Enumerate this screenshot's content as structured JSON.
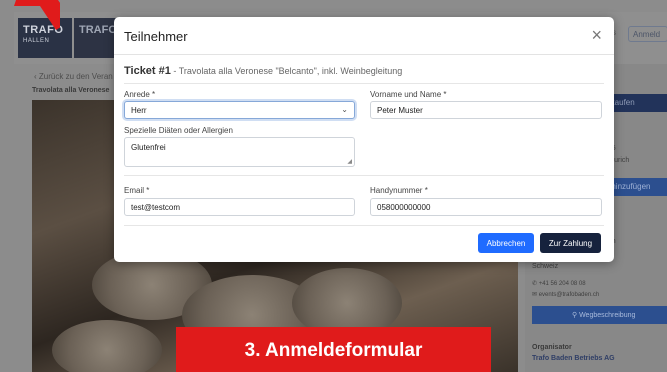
{
  "background": {
    "logo_primary": "TRAFO",
    "logo_primary_sub": "HALLEN",
    "logo_secondary": "TRAFO",
    "header_link": "s",
    "header_button": "Anmeld",
    "back_link": "Zurück zu den Veran",
    "event_title": "Travolata alla Veronese",
    "buy_button": "h kaufen",
    "date_partial": "025",
    "location_partial": "e/Zurich",
    "blue_button": "er hinzufügen",
    "venue_partial": "den",
    "country": "Schweiz",
    "phone": "+41 56 204 08 08",
    "email": "events@trafobaden.ch",
    "directions_button": "Wegbeschreibung",
    "organizer_label": "Organisator",
    "organizer_name": "Trafo Baden Betriebs AG"
  },
  "modal": {
    "title": "Teilnehmer",
    "close_symbol": "×",
    "ticket_number": "Ticket #1",
    "ticket_description": " - Travolata alla Veronese \"Belcanto\", inkl. Weinbegleitung",
    "fields": {
      "salutation": {
        "label": "Anrede *",
        "value": "Herr"
      },
      "full_name": {
        "label": "Vorname und Name *",
        "value": "Peter Muster"
      },
      "diet": {
        "label": "Spezielle Diäten oder Allergien",
        "value": "Glutenfrei"
      },
      "email": {
        "label": "Email *",
        "value": "test@testcom"
      },
      "mobile": {
        "label": "Handynummer *",
        "value": "058000000000"
      }
    },
    "buttons": {
      "cancel": "Abbrechen",
      "pay": "Zur Zahlung"
    }
  },
  "caption": "3. Anmeldeformular",
  "colors": {
    "primary_button": "#1f6bff",
    "dark_button": "#16223d",
    "caption_red": "#e01b1b"
  }
}
